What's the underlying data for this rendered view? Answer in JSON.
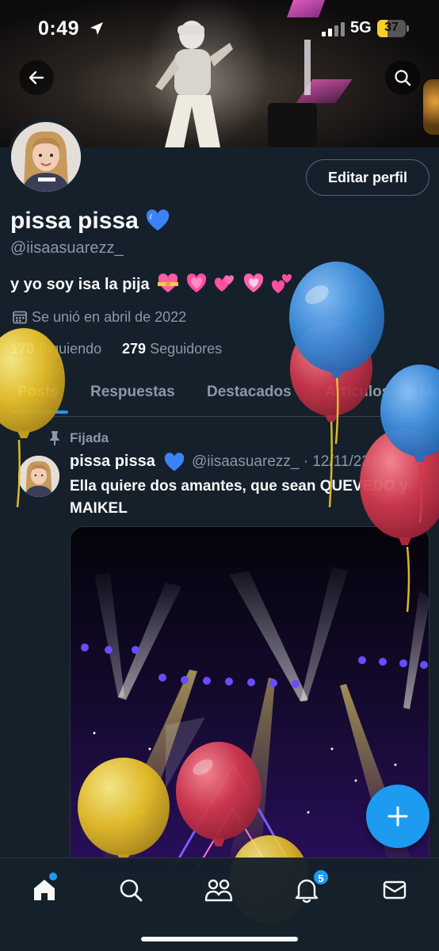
{
  "status_bar": {
    "time": "0:49",
    "network": "5G",
    "battery_level": "37",
    "battery_fraction": 0.37
  },
  "profile": {
    "display_name": "pissa pissa",
    "handle": "@iisaasuarezz_",
    "edit_button": "Editar perfil",
    "bio": "y yo soy isa la pija",
    "joined": "Se unió en abril de 2022",
    "following_count": "170",
    "following_label": "Siguiendo",
    "followers_count": "279",
    "followers_label": "Seguidores"
  },
  "tabs": [
    {
      "label": "Posts",
      "active": true
    },
    {
      "label": "Respuestas",
      "active": false
    },
    {
      "label": "Destacados",
      "active": false
    },
    {
      "label": "Artículos",
      "active": false
    },
    {
      "label": "Mu",
      "active": false
    }
  ],
  "pinned_post": {
    "pinned_label": "Fijada",
    "author_name": "pissa pissa",
    "author_meta": "@iisaasuarezz_ · 12/11/23",
    "text": "Ella quiere dos amantes, que sean QUEVEDO y MAIKEL"
  },
  "bottom_nav": {
    "notifications_badge": "5",
    "items": [
      "home-icon",
      "search-icon",
      "communities-icon",
      "notifications-icon",
      "messages-icon"
    ]
  },
  "colors": {
    "background": "#15202b",
    "accent": "#1d9bf0",
    "muted_text": "#8b98a5",
    "balloon_blue": "#3f8fde",
    "balloon_red": "#d2394f",
    "balloon_yellow": "#e8c12a"
  }
}
